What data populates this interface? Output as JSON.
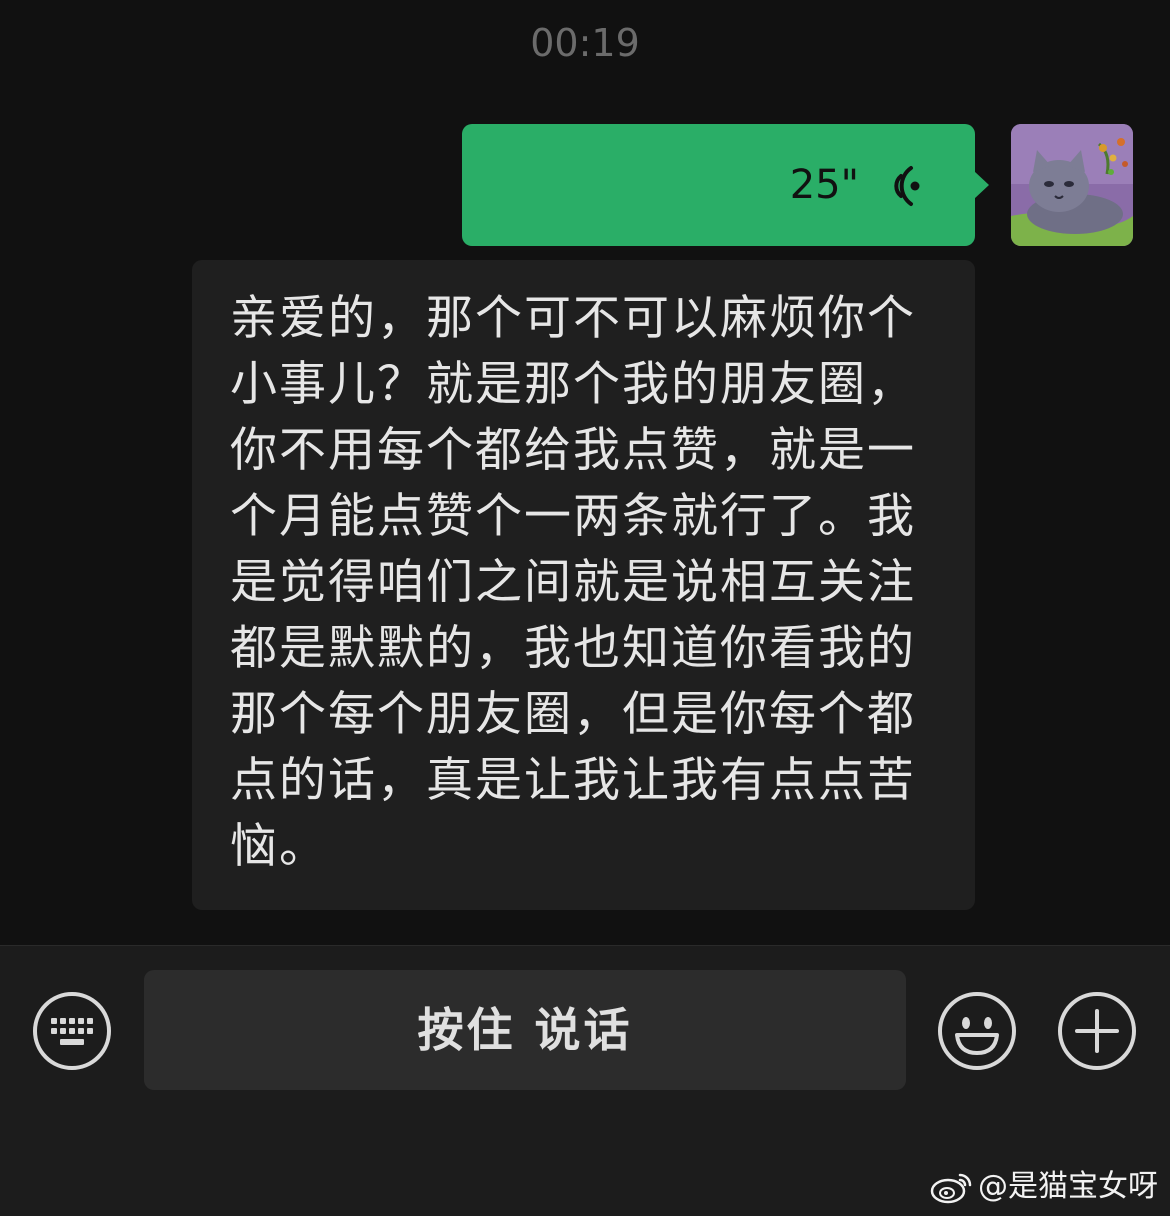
{
  "status": {
    "time": "00:19"
  },
  "voice_message": {
    "duration": "25\"",
    "bubble_color": "#2aae67"
  },
  "transcript": {
    "text": "亲爱的，那个可不可以麻烦你个小事儿？就是那个我的朋友圈，你不用每个都给我点赞，就是一个月能点赞个一两条就行了。我是觉得咱们之间就是说相互关注都是默默的，我也知道你看我的那个每个朋友圈，但是你每个都点的话，真是让我让我有点点苦恼。"
  },
  "input_bar": {
    "hold_to_talk_label": "按住 说话",
    "icons": [
      "keyboard-icon",
      "emoji-icon",
      "plus-icon"
    ]
  },
  "watermark": {
    "handle": "@是猫宝女呀",
    "icon": "weibo-icon"
  }
}
